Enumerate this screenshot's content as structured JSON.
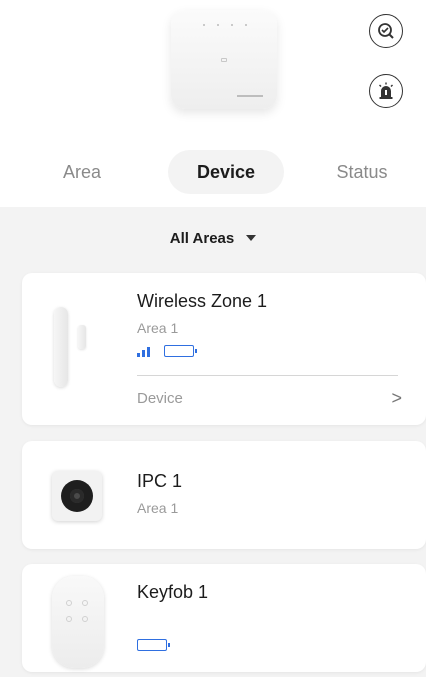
{
  "icons": {
    "search": "search-device-icon",
    "alarm": "siren-icon"
  },
  "tabs": [
    {
      "label": "Area",
      "selected": false
    },
    {
      "label": "Device",
      "selected": true
    },
    {
      "label": "Status",
      "selected": false
    }
  ],
  "filter": {
    "label": "All Areas"
  },
  "devices": [
    {
      "name": "Wireless Zone 1",
      "area": "Area 1",
      "signal": "signal-strength-icon",
      "battery": "battery-full-icon",
      "link_label": "Device",
      "link_icon": ">"
    },
    {
      "name": "IPC 1",
      "area": "Area 1"
    },
    {
      "name": "Keyfob 1",
      "battery": "battery-full-icon"
    }
  ],
  "colors": {
    "accent": "#2f6fe0",
    "background": "#f3f3f3"
  }
}
